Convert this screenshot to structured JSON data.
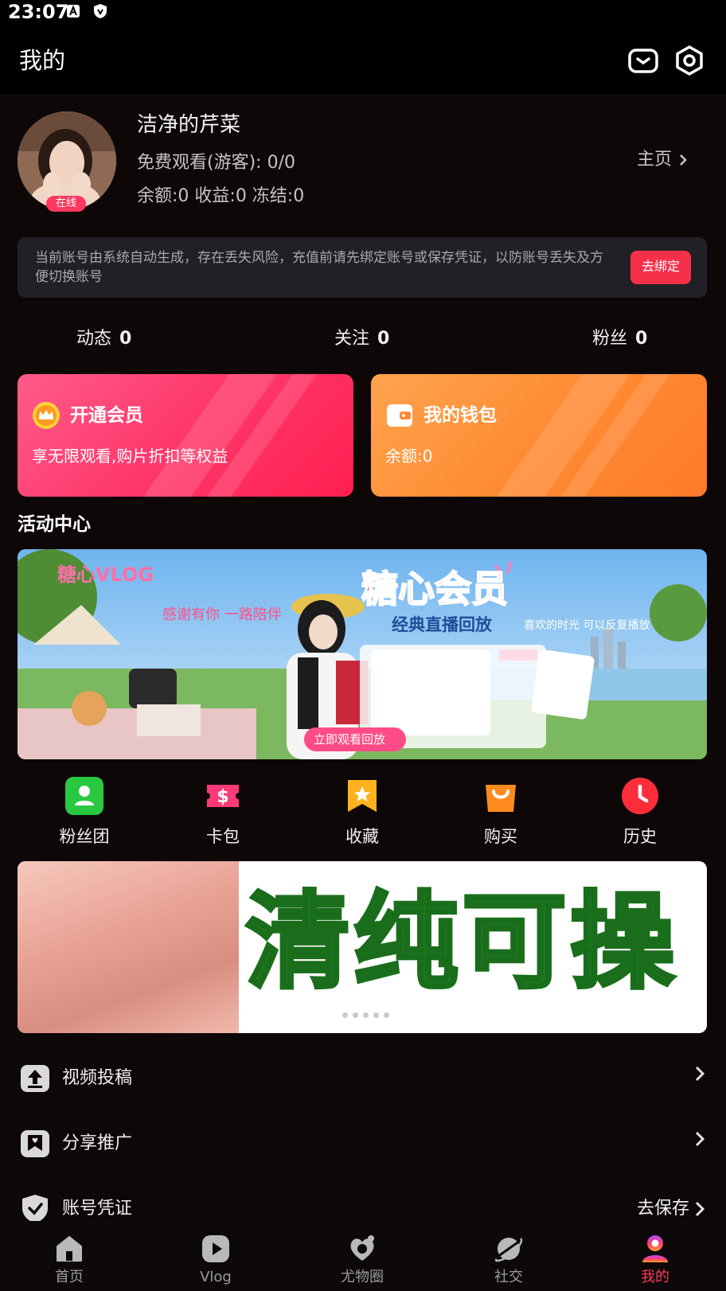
{
  "status_bar": {
    "time": "23:07"
  },
  "header": {
    "title": "我的"
  },
  "profile": {
    "username": "洁净的芹菜",
    "online_badge": "在线",
    "free_watch": "免费观看(游客): 0/0",
    "balances": "余额:0 收益:0 冻结:0",
    "homepage_link": "主页"
  },
  "notice": {
    "text": "当前账号由系统自动生成，存在丢失风险，充值前请先绑定账号或保存凭证，以防账号丢失及方便切换账号",
    "bind_button": "去绑定"
  },
  "stats": {
    "posts_label": "动态",
    "posts_value": "0",
    "following_label": "关注",
    "following_value": "0",
    "fans_label": "粉丝",
    "fans_value": "0"
  },
  "cards": {
    "vip_title": "开通会员",
    "vip_subtitle": "享无限观看,购片折扣等权益",
    "wallet_title": "我的钱包",
    "wallet_subtitle": "余额:0"
  },
  "activity": {
    "section_title": "活动中心",
    "banner_brand": "糖心VLOG",
    "banner_title": "糖心会员",
    "banner_subtitle": "经典直播回放",
    "banner_thanks": "感谢有你 一路陪伴",
    "banner_button": "立即观看回放",
    "banner_side_text": "喜欢的时光 可以反复播放"
  },
  "quick_actions": [
    {
      "label": "粉丝团",
      "icon": "fan-group-icon",
      "color": "#28c840"
    },
    {
      "label": "卡包",
      "icon": "card-pack-icon",
      "color": "#ff3a78"
    },
    {
      "label": "收藏",
      "icon": "favorites-icon",
      "color": "#ffb21e"
    },
    {
      "label": "购买",
      "icon": "purchase-icon",
      "color": "#ff8a1e"
    },
    {
      "label": "历史",
      "icon": "history-icon",
      "color": "#ff2d3a"
    }
  ],
  "ad_banner": {
    "text": "清纯可操"
  },
  "menu": [
    {
      "label": "视频投稿",
      "right": ""
    },
    {
      "label": "分享推广",
      "right": ""
    },
    {
      "label": "账号凭证",
      "right": "去保存"
    }
  ],
  "tabs": [
    {
      "label": "首页"
    },
    {
      "label": "Vlog"
    },
    {
      "label": "尤物圈"
    },
    {
      "label": "社交"
    },
    {
      "label": "我的"
    }
  ],
  "colors": {
    "accent": "#ff3a5c",
    "vip_card": "#ff3a6e",
    "wallet_card": "#ff8a32",
    "ad_text": "#1d7a1e"
  }
}
